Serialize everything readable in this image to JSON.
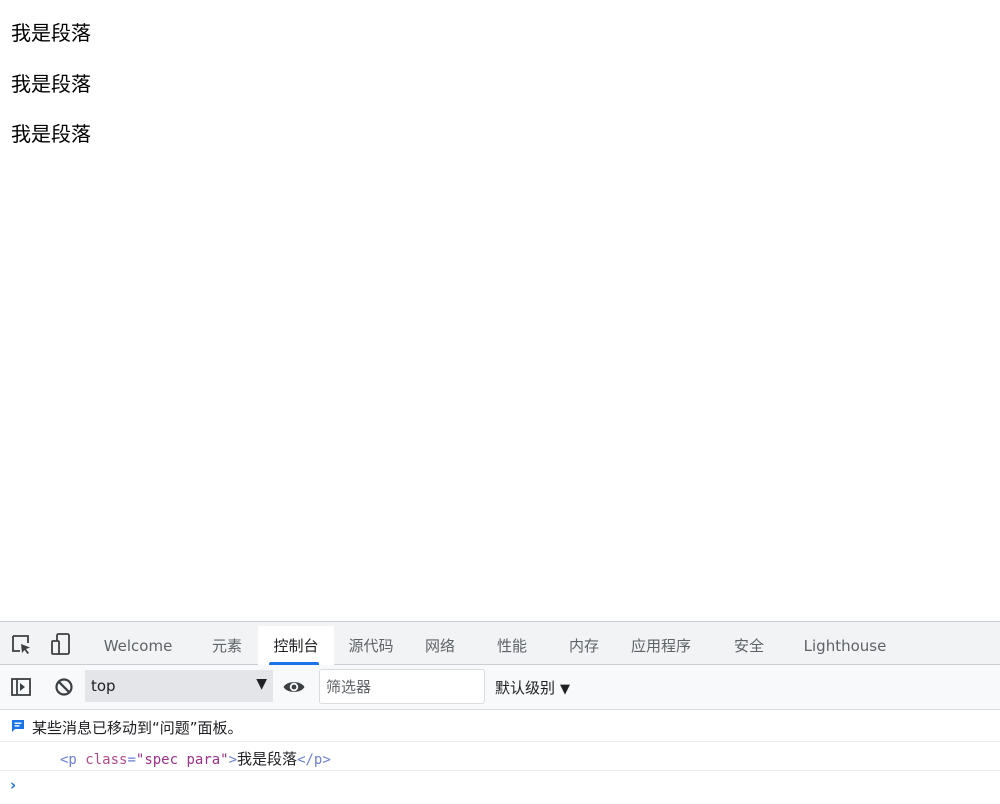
{
  "page": {
    "paragraphs": [
      "我是段落",
      "我是段落",
      "我是段落"
    ]
  },
  "devtools": {
    "tabs": [
      {
        "label": "Welcome",
        "active": false
      },
      {
        "label": "元素",
        "active": false
      },
      {
        "label": "控制台",
        "active": true
      },
      {
        "label": "源代码",
        "active": false
      },
      {
        "label": "网络",
        "active": false
      },
      {
        "label": "性能",
        "active": false
      },
      {
        "label": "内存",
        "active": false
      },
      {
        "label": "应用程序",
        "active": false
      },
      {
        "label": "安全",
        "active": false
      },
      {
        "label": "Lighthouse",
        "active": false
      }
    ],
    "toolbar": {
      "context": "top",
      "filter_placeholder": "筛选器",
      "levels_label": "默认级别"
    },
    "console": {
      "info_message": "某些消息已移动到“问题”面板。",
      "log": {
        "open_tag": "<p",
        "attr_name": "class",
        "eq": "=",
        "attr_value": "\"spec para\"",
        "open_tag_end": ">",
        "inner_text": "我是段落",
        "close_tag": "</p>"
      },
      "prompt": "›"
    },
    "colors": {
      "accent": "#1a73e8",
      "tabbar_bg": "#f1f3f4",
      "toolbar_bg": "#f8f9fa",
      "tag": "#6b7fd7",
      "attr": "#b24a8a"
    },
    "icons": [
      "inspect-element-icon",
      "device-toolbar-icon",
      "sidebar-toggle-icon",
      "clear-console-icon",
      "live-expression-eye-icon",
      "info-message-icon"
    ]
  }
}
